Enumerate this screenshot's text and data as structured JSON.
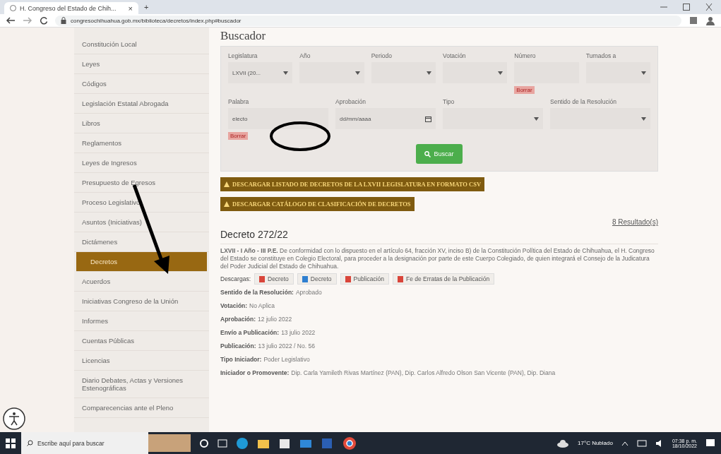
{
  "browser": {
    "tab_title": "H. Congreso del Estado de Chih...",
    "tab_close": "×",
    "new_tab": "+",
    "url": "congresochihuahua.gob.mx/biblioteca/decretos/index.php#buscador"
  },
  "sidebar": {
    "items": [
      {
        "label": "Constitución Local",
        "selected": false
      },
      {
        "label": "Leyes",
        "selected": false
      },
      {
        "label": "Códigos",
        "selected": false
      },
      {
        "label": "Legislación Estatal Abrogada",
        "selected": false
      },
      {
        "label": "Libros",
        "selected": false
      },
      {
        "label": "Reglamentos",
        "selected": false
      },
      {
        "label": "Leyes de Ingresos",
        "selected": false
      },
      {
        "label": "Presupuesto de Egresos",
        "selected": false
      },
      {
        "label": "Proceso Legislativo",
        "selected": false
      },
      {
        "label": "Asuntos (Iniciativas)",
        "selected": false
      },
      {
        "label": "Dictámenes",
        "selected": false
      },
      {
        "label": "Decretos",
        "selected": true
      },
      {
        "label": "Acuerdos",
        "selected": false
      },
      {
        "label": "Iniciativas Congreso de la Unión",
        "selected": false
      },
      {
        "label": "Informes",
        "selected": false
      },
      {
        "label": "Cuentas Públicas",
        "selected": false
      },
      {
        "label": "Licencias",
        "selected": false
      },
      {
        "label": "Diario Debates, Actas y Versiones Estenográficas",
        "selected": false
      },
      {
        "label": "Comparecencias ante el Pleno",
        "selected": false
      }
    ]
  },
  "search": {
    "title": "Buscador",
    "row_1": [
      {
        "label": "Legislatura",
        "kind": "select",
        "value": "LXVII (20..."
      },
      {
        "label": "Año",
        "kind": "select"
      },
      {
        "label": "Periodo",
        "kind": "select"
      },
      {
        "label": "Votación",
        "kind": "select"
      },
      {
        "label": "Número",
        "kind": "text",
        "clear": "Borrar"
      },
      {
        "label": "Turnados a",
        "kind": "select"
      }
    ],
    "row_2": [
      {
        "label": "Palabra",
        "kind": "text",
        "value": "electo",
        "clear": "Borrar"
      },
      {
        "label": "Aprobación",
        "kind": "date",
        "value": "dd/mm/aaaa"
      },
      {
        "label": "Tipo",
        "kind": "select"
      },
      {
        "label": "Sentido de la Resolución",
        "kind": "select"
      }
    ],
    "button": "Buscar"
  },
  "downloads": [
    "DESCARGAR LISTADO DE DECRETOS DE LA LXVII LEGISLATURA EN FORMATO CSV",
    "DESCARGAR CATÁLOGO DE CLASIFICACIÓN DE DECRETOS"
  ],
  "results_count": "8 Resultado(s)",
  "decree": {
    "title": "Decreto 272/22",
    "summary": "**LXVII - I Año - III P.E.** De conformidad con lo dispuesto en el artículo 64, fracción XV, inciso B) de la Constitución Política del Estado de Chihuahua, el H. Congreso del Estado se constituye en Colegio Electoral, para proceder a la designación por parte de este Cuerpo Colegiado, de quien integrará el Consejo de la Judicatura del Poder Judicial del Estado de Chihuahua.",
    "files_label": "Descargas:",
    "files": [
      {
        "label": "Decreto",
        "color": "#d9453a"
      },
      {
        "label": "Decreto",
        "color": "#2f7fd0"
      },
      {
        "label": "Publicación",
        "color": "#d9453a"
      },
      {
        "label": "Fe de Erratas de la Publicación",
        "color": "#d9453a"
      }
    ],
    "fields": [
      {
        "label": "Sentido de la Resolución:",
        "value": "Aprobado"
      },
      {
        "label": "Votación:",
        "value": "No Aplica"
      },
      {
        "label": "Aprobación:",
        "value": "12 julio 2022"
      },
      {
        "label": "Envío a Publicación:",
        "value": "13 julio 2022"
      },
      {
        "label": "Publicación:",
        "value": "13 julio 2022 / No. 56"
      },
      {
        "label": "Tipo Iniciador:",
        "value": "Poder Legislativo"
      },
      {
        "label": "Iniciador o Promovente:",
        "value": "Dip. Carla Yamileth Rivas Martínez (PAN), Dip. Carlos Alfredo Olson San Vicente (PAN), Dip. Diana"
      }
    ]
  },
  "taskbar": {
    "search_placeholder": "Escribe aquí para buscar",
    "weather": "17°C Nublado",
    "time": "07:38 p. m.",
    "date": "18/10/2022"
  }
}
